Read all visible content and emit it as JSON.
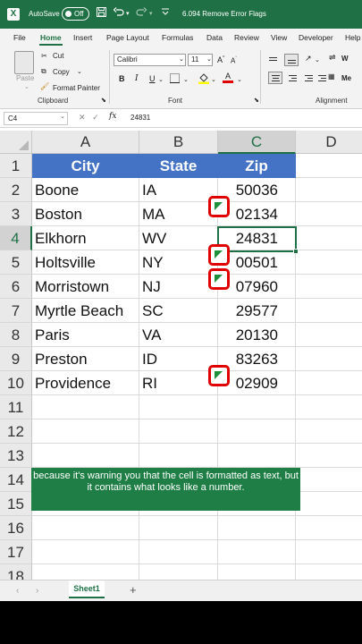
{
  "titlebar": {
    "logo": "X",
    "autosave_label": "AutoSave",
    "autosave_state": "Off",
    "save_icon": "save-icon",
    "undo_icon": "undo-icon",
    "redo_icon": "redo-icon",
    "filename": "6.094 Remove Error Flags",
    "chevron": "⌄"
  },
  "menu": [
    "File",
    "Home",
    "Insert",
    "Page Layout",
    "Formulas",
    "Data",
    "Review",
    "View",
    "Developer",
    "Help"
  ],
  "ribbon": {
    "paste": "Paste",
    "cut": "Cut",
    "copy": "Copy",
    "format_painter": "Format Painter",
    "clipboard_group": "Clipboard",
    "font_name": "Calibri",
    "font_size": "11",
    "bold": "B",
    "italic": "I",
    "underline": "U",
    "font_group": "Font",
    "wrap_partial": "W",
    "merge_partial": "Me",
    "alignment_group": "Alignment"
  },
  "formula_bar": {
    "name_box": "C4",
    "fx": "fx",
    "value": "24831"
  },
  "columns": [
    "A",
    "B",
    "C",
    "D"
  ],
  "rows": [
    "1",
    "2",
    "3",
    "4",
    "5",
    "6",
    "7",
    "8",
    "9",
    "10",
    "11",
    "12",
    "13",
    "14",
    "15",
    "16",
    "17",
    "18"
  ],
  "table": {
    "headers": [
      "City",
      "State",
      "Zip"
    ],
    "data": [
      [
        "Boone",
        "IA",
        "50036"
      ],
      [
        "Boston",
        "MA",
        "02134"
      ],
      [
        "Elkhorn",
        "WV",
        "24831"
      ],
      [
        "Holtsville",
        "NY",
        "00501"
      ],
      [
        "Morristown",
        "NJ",
        "07960"
      ],
      [
        "Myrtle Beach",
        "SC",
        "29577"
      ],
      [
        "Paris",
        "VA",
        "20130"
      ],
      [
        "Preston",
        "ID",
        "83263"
      ],
      [
        "Providence",
        "RI",
        "02909"
      ]
    ]
  },
  "selected_cell": "C4",
  "error_flag_rows": [
    "3",
    "5",
    "6",
    "10"
  ],
  "caption": "because it's warning you that the cell is formatted as text, but it contains what looks like a number.",
  "sheets": [
    "Sheet1"
  ],
  "add_sheet": "+",
  "colors": {
    "excel_green": "#1f7145",
    "table_header": "#4472c4",
    "error_highlight": "#e00000",
    "caption_bg": "#1f7e45"
  }
}
